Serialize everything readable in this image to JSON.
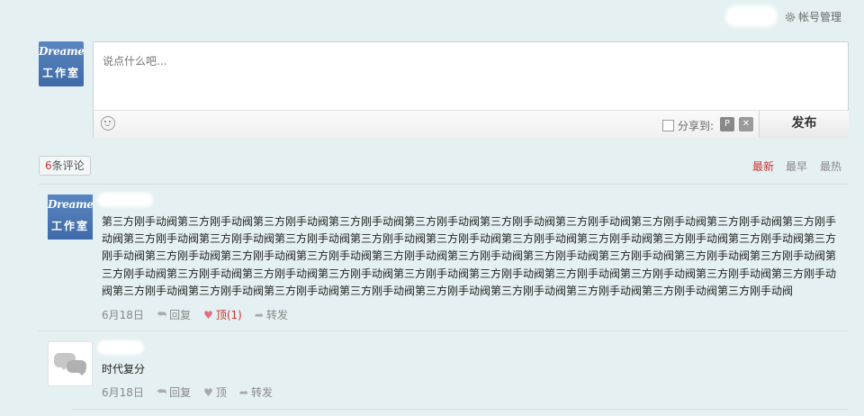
{
  "header": {
    "account_label": "帐号管理",
    "account_icon": "gear-icon"
  },
  "avatar_logo": {
    "line1": "Dreame",
    "line2": "工作室"
  },
  "composer": {
    "placeholder": "说点什么吧...",
    "share_label": "分享到:",
    "publish_label": "发布"
  },
  "comments_header": {
    "count": "6",
    "count_suffix": "条评论",
    "sort": [
      "最新",
      "最早",
      "最热"
    ]
  },
  "comments": [
    {
      "text": "第三方刚手动阀第三方刚手动阀第三方刚手动阀第三方刚手动阀第三方刚手动阀第三方刚手动阀第三方刚手动阀第三方刚手动阀第三方刚手动阀第三方刚手动阀第三方刚手动阀第三方刚手动阀第三方刚手动阀第三方刚手动阀第三方刚手动阀第三方刚手动阀第三方刚手动阀第三方刚手动阀第三方刚手动阀第三方刚手动阀第三方刚手动阀第三方刚手动阀第三方刚手动阀第三方刚手动阀第三方刚手动阀第三方刚手动阀第三方刚手动阀第三方刚手动阀第三方刚手动阀第三方刚手动阀第三方刚手动阀第三方刚手动阀第三方刚手动阀第三方刚手动阀第三方刚手动阀第三方刚手动阀第三方刚手动阀第三方刚手动阀第三方刚手动阀第三方刚手动阀第三方刚手动阀第三方刚手动阀第三方刚手动阀第三方刚手动阀第三方刚手动阀第三方刚手动阀第三方刚手动阀第三方刚手动阀",
      "date": "6月18日",
      "reply": "回复",
      "like": "顶(1)",
      "forward": "转发"
    },
    {
      "text": "时代复分",
      "date": "6月18日",
      "reply": "回复",
      "like": "顶",
      "forward": "转发"
    }
  ]
}
